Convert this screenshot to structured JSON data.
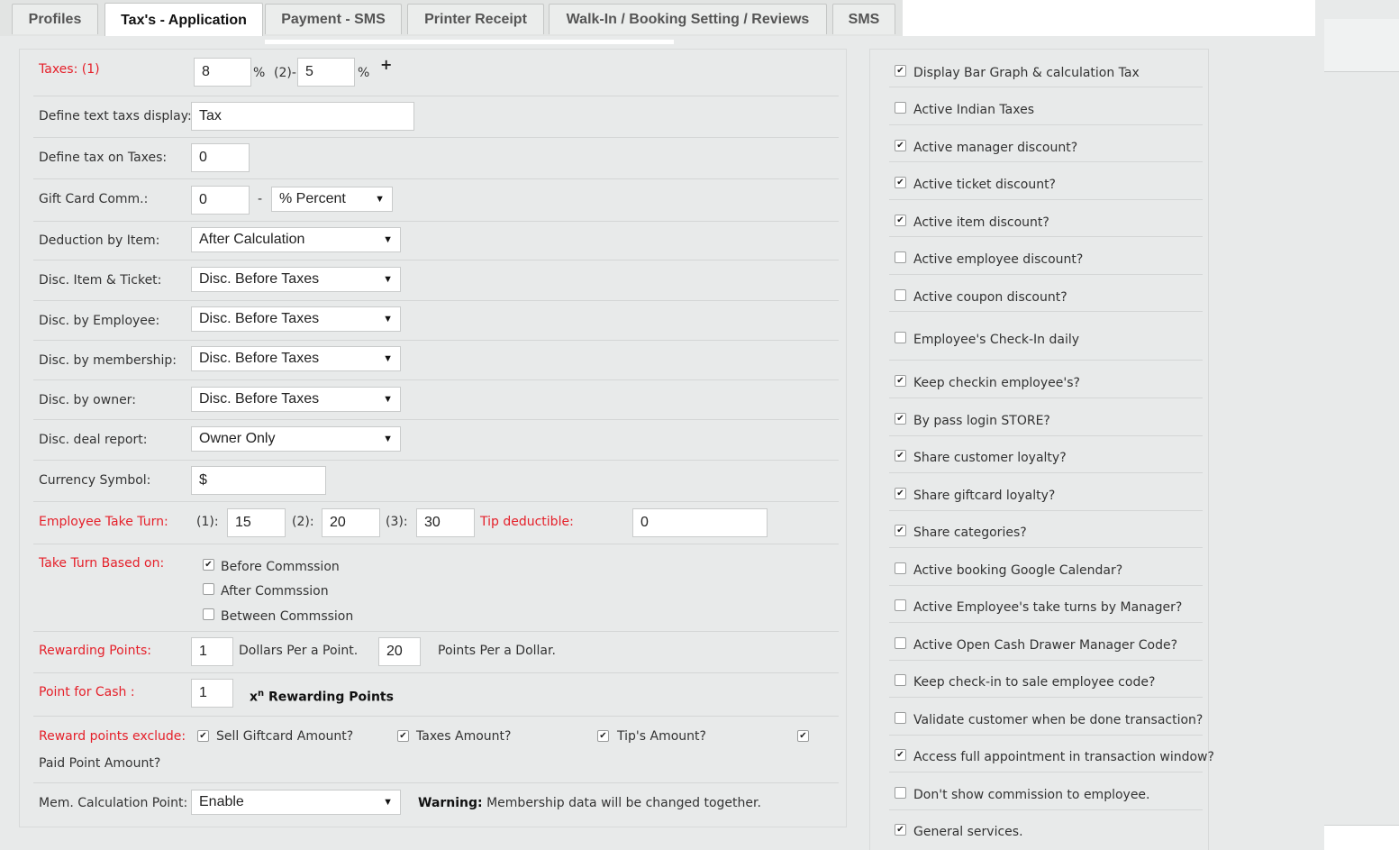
{
  "tabs": [
    {
      "label": "Profiles"
    },
    {
      "label": "Tax's - Application"
    },
    {
      "label": "Payment - SMS"
    },
    {
      "label": "Printer Receipt"
    },
    {
      "label": "Walk-In / Booking Setting / Reviews"
    },
    {
      "label": "SMS"
    }
  ],
  "left": {
    "taxes": {
      "label": "Taxes: (1)",
      "value1": "8",
      "pct1": "%",
      "sep": "(2)-",
      "value2": "5",
      "pct2": "%",
      "plus": "+"
    },
    "text_taxs_display": {
      "label": "Define text taxs display:",
      "value": "Tax"
    },
    "tax_on_taxes": {
      "label": "Define tax on Taxes:",
      "value": "0"
    },
    "gift_card_comm": {
      "label": "Gift Card Comm.:",
      "value": "0",
      "dash": "-",
      "select": "% Percent"
    },
    "deduction_by_item": {
      "label": "Deduction by Item:",
      "select": "After Calculation"
    },
    "disc_item_ticket": {
      "label": "Disc. Item & Ticket:",
      "select": "Disc. Before Taxes"
    },
    "disc_by_employee": {
      "label": "Disc. by Employee:",
      "select": "Disc. Before Taxes"
    },
    "disc_by_membership": {
      "label": "Disc. by membership:",
      "select": "Disc. Before Taxes"
    },
    "disc_by_owner": {
      "label": "Disc. by owner:",
      "select": "Disc. Before Taxes"
    },
    "disc_deal_report": {
      "label": "Disc. deal report:",
      "select": "Owner Only"
    },
    "currency_symbol": {
      "label": "Currency Symbol:",
      "value": "$"
    },
    "employee_take_turn": {
      "label": "Employee Take Turn:",
      "l1": "(1):",
      "v1": "15",
      "l2": "(2):",
      "v2": "20",
      "l3": "(3):",
      "v3": "30",
      "tip_label": "Tip deductible:",
      "tip_value": "0"
    },
    "take_turn_based_on": {
      "label": "Take Turn Based on:",
      "options": [
        {
          "label": "Before Commssion",
          "checked": true
        },
        {
          "label": "After Commssion",
          "checked": false
        },
        {
          "label": "Between Commssion",
          "checked": false
        }
      ]
    },
    "rewarding_points": {
      "label": "Rewarding Points:",
      "v1": "1",
      "t1": "Dollars Per a Point.",
      "v2": "20",
      "t2": "Points Per a Dollar."
    },
    "point_for_cash": {
      "label": "Point for Cash :",
      "value": "1",
      "x": "x",
      "sup": "n",
      "text": " Rewarding Points"
    },
    "reward_points_exclude": {
      "label": "Reward points exclude:",
      "options": [
        {
          "label": "Sell Giftcard Amount?",
          "checked": true
        },
        {
          "label": "Taxes Amount?",
          "checked": true
        },
        {
          "label": "Tip's Amount?",
          "checked": true
        },
        {
          "label": "Paid Point Amount?",
          "checked": true
        }
      ]
    },
    "mem_calculation_point": {
      "label": "Mem. Calculation Point:",
      "select": "Enable",
      "warning_bold": "Warning:",
      "warning_text": " Membership data will be changed together."
    }
  },
  "right": {
    "options": [
      {
        "label": "Display Bar Graph & calculation Tax",
        "checked": true
      },
      {
        "label": "Active Indian Taxes",
        "checked": false
      },
      {
        "label": "Active manager discount?",
        "checked": true
      },
      {
        "label": "Active ticket discount?",
        "checked": true
      },
      {
        "label": "Active item discount?",
        "checked": true
      },
      {
        "label": "Active employee discount?",
        "checked": false
      },
      {
        "label": "Active coupon discount?",
        "checked": false
      },
      {
        "label": "Employee's Check-In daily",
        "checked": false
      },
      {
        "label": "Keep checkin employee's?",
        "checked": true
      },
      {
        "label": "By pass login STORE?",
        "checked": true
      },
      {
        "label": "Share customer loyalty?",
        "checked": true
      },
      {
        "label": "Share giftcard loyalty?",
        "checked": true
      },
      {
        "label": "Share categories?",
        "checked": true
      },
      {
        "label": "Active booking Google Calendar?",
        "checked": false
      },
      {
        "label": "Active Employee's take turns by Manager?",
        "checked": false
      },
      {
        "label": "Active Open Cash Drawer Manager Code?",
        "checked": false
      },
      {
        "label": "Keep check-in to sale employee code?",
        "checked": false
      },
      {
        "label": "Validate customer when be done transaction?",
        "checked": false
      },
      {
        "label": "Access full appointment in transaction window?",
        "checked": true
      },
      {
        "label": "Don't show commission to employee.",
        "checked": false
      },
      {
        "label": "General services.",
        "checked": true
      }
    ]
  },
  "colors": {
    "accent_red": "#e5202a",
    "panel_bg": "#e8eaea"
  }
}
